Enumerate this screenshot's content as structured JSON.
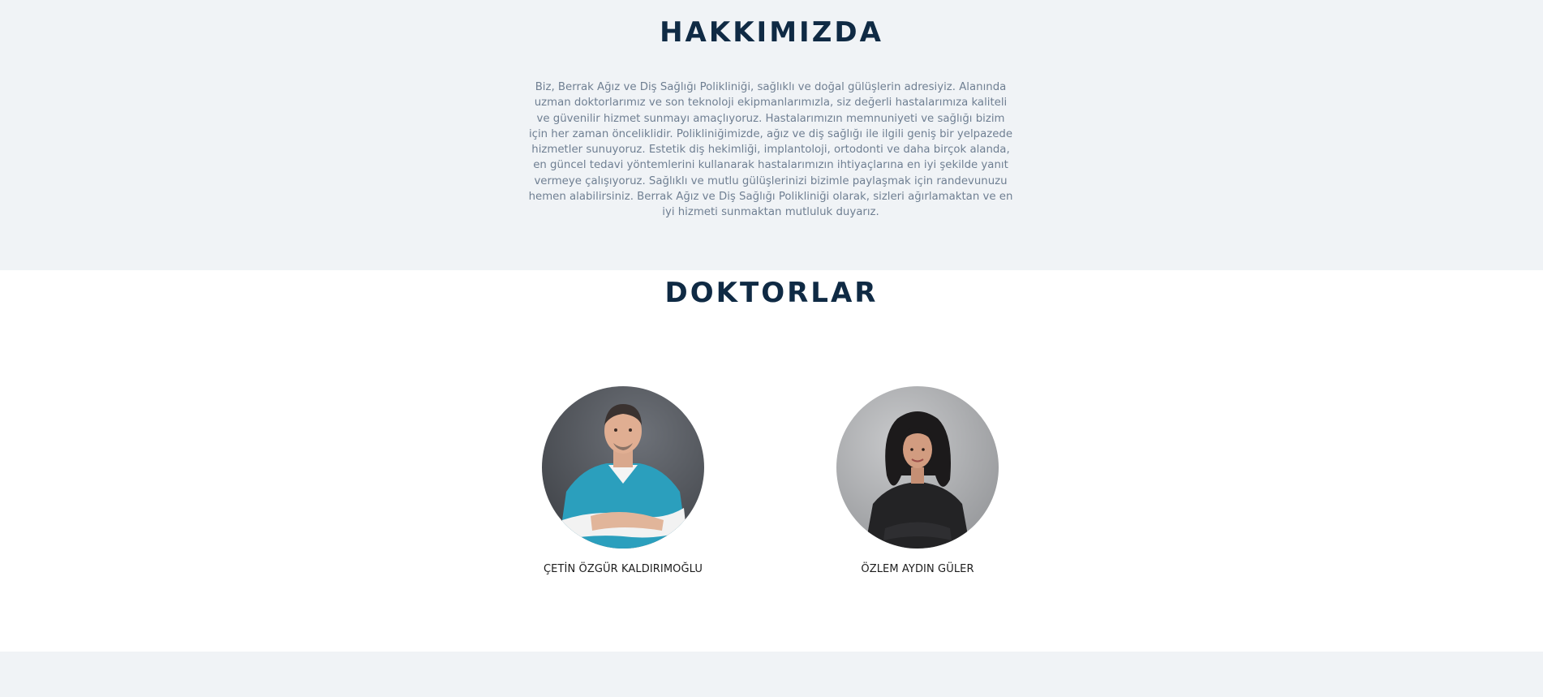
{
  "about": {
    "title": "HAKKIMIZDA",
    "text": "Biz, Berrak Ağız ve Diş Sağlığı Polikliniği, sağlıklı ve doğal gülüşlerin adresiyiz. Alanında uzman doktorlarımız ve son teknoloji ekipmanlarımızla, siz değerli hastalarımıza kaliteli ve güvenilir hizmet sunmayı amaçlıyoruz. Hastalarımızın memnuniyeti ve sağlığı bizim için her zaman önceliklidir. Polikliniğimizde, ağız ve diş sağlığı ile ilgili geniş bir yelpazede hizmetler sunuyoruz. Estetik diş hekimliği, implantoloji, ortodonti ve daha birçok alanda, en güncel tedavi yöntemlerini kullanarak hastalarımızın ihtiyaçlarına en iyi şekilde yanıt vermeye çalışıyoruz. Sağlıklı ve mutlu gülüşlerinizi bizimle paylaşmak için randevunuzu hemen alabilirsiniz. Berrak Ağız ve Diş Sağlığı Polikliniği olarak, sizleri ağırlamaktan ve en iyi hizmeti sunmaktan mutluluk duyarız."
  },
  "doctors": {
    "title": "DOKTORLAR",
    "items": [
      {
        "name": "ÇETİN ÖZGÜR KALDIRIMOĞLU",
        "photo": "male-doctor-photo"
      },
      {
        "name": "ÖZLEM AYDIN GÜLER",
        "photo": "female-doctor-photo"
      }
    ]
  },
  "colors": {
    "heading": "#0f2a44",
    "body_text": "#6f7f92",
    "section_bg": "#f0f3f6",
    "card_bg": "#ffffff"
  }
}
